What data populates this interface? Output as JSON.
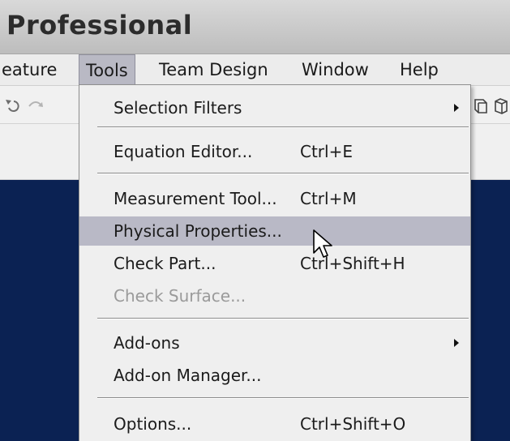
{
  "window": {
    "title": "Professional"
  },
  "menubar": {
    "items": [
      {
        "label": "eature"
      },
      {
        "label": "Tools"
      },
      {
        "label": "Team Design"
      },
      {
        "label": "Window"
      },
      {
        "label": "Help"
      }
    ]
  },
  "toolbar": {
    "icons": [
      "undo-icon",
      "redo-icon",
      "view-cube-icon",
      "view-box-icon"
    ]
  },
  "tools_menu": {
    "items": [
      {
        "label": "Selection Filters",
        "shortcut": "",
        "submenu": true
      },
      {
        "label": "Equation Editor...",
        "shortcut": "Ctrl+E"
      },
      {
        "label": "Measurement Tool...",
        "shortcut": "Ctrl+M"
      },
      {
        "label": "Physical Properties...",
        "shortcut": "",
        "highlighted": true
      },
      {
        "label": "Check Part...",
        "shortcut": "Ctrl+Shift+H"
      },
      {
        "label": "Check Surface...",
        "shortcut": "",
        "disabled": true
      },
      {
        "label": "Add-ons",
        "shortcut": "",
        "submenu": true
      },
      {
        "label": "Add-on Manager...",
        "shortcut": ""
      },
      {
        "label": "Options...",
        "shortcut": "Ctrl+Shift+O"
      }
    ]
  },
  "colors": {
    "workspace_background": "#0b2253",
    "menu_background": "#efefef",
    "highlight": "#b9b9c6",
    "disabled_text": "#9a9a9a"
  }
}
